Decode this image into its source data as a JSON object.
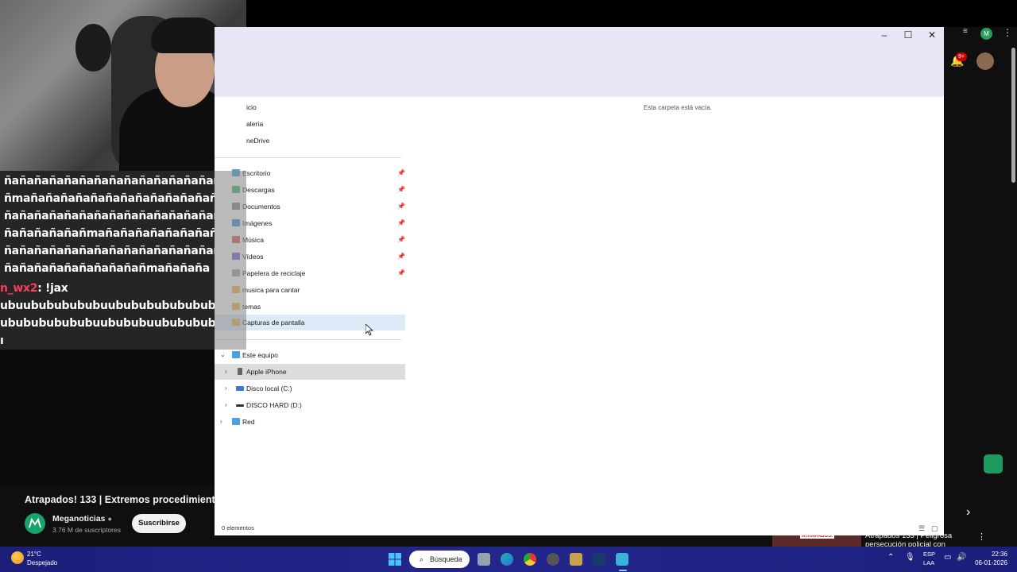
{
  "explorer": {
    "nav_items": [
      {
        "label": "icio",
        "color": "#3a7bd5"
      },
      {
        "label": "alería",
        "color": "#3a7bd5"
      },
      {
        "label": "neDrive",
        "color": "#3a7bd5"
      },
      {
        "label": "Escritorio",
        "color": "#4aa0e0",
        "pinned": true
      },
      {
        "label": "Descargas",
        "color": "#3bb36a",
        "pinned": true
      },
      {
        "label": "Documentos",
        "color": "#888888",
        "pinned": true
      },
      {
        "label": "Imágenes",
        "color": "#3a89d8",
        "pinned": true
      },
      {
        "label": "Música",
        "color": "#d8555a",
        "pinned": true
      },
      {
        "label": "Vídeos",
        "color": "#7a5ad8",
        "pinned": true
      },
      {
        "label": "Papelera de reciclaje",
        "color": "#9aa4b0",
        "pinned": true
      },
      {
        "label": "musica para cantar",
        "color": "#e8b84a"
      },
      {
        "label": "temas",
        "color": "#e8b84a"
      },
      {
        "label": "Capturas de pantalla",
        "color": "#e8b84a",
        "selected": true
      }
    ],
    "tree": [
      {
        "label": "Este equipo",
        "color": "#4aa0e0"
      },
      {
        "label": "Apple iPhone",
        "color": "#666666",
        "hover": true
      },
      {
        "label": "Disco local (C:)",
        "color": "#3a7bd5"
      },
      {
        "label": "DISCO HARD (D:)",
        "color": "#333333"
      },
      {
        "label": "Red",
        "color": "#4aa0e0"
      }
    ],
    "empty_message": "Esta carpeta está vacía.",
    "status": "0 elementos"
  },
  "chat": {
    "lines": [
      "ñañañañañañañañañañañañañañañañañaña",
      "ñmañañañañañañañañañañañañañañañaña",
      "ñañañañañañañañañañañañañañañañaña",
      "ñañañañañañmañañañañañañañañañaña",
      "ñañañañañañañañañañañañañañañañaña",
      "ñañañañañañañañañañmañañaña"
    ],
    "user": "n_wx2",
    "message": ": !jax",
    "lines2": [
      "ubuubububububuubububububububub",
      "ububububububuubububuubububububu",
      "ı"
    ]
  },
  "video": {
    "title": "Atrapados! 133 | Extremos procedimient",
    "channel": "Meganoticias",
    "subscribers": "3.76 M de suscriptores",
    "subscribe_label": "Suscribirse",
    "notification_count": "9+",
    "avatar_letter": "M",
    "recommended_badge": "ATRAPADOS!",
    "recommended_title": "Atrapados 133 | Peligrosa persecución policial con"
  },
  "taskbar": {
    "temperature": "21°C",
    "weather": "Despejado",
    "search_label": "Búsqueda",
    "lang_top": "ESP",
    "lang_bottom": "LAA",
    "time": "22:36",
    "date": "06-01-2026"
  }
}
